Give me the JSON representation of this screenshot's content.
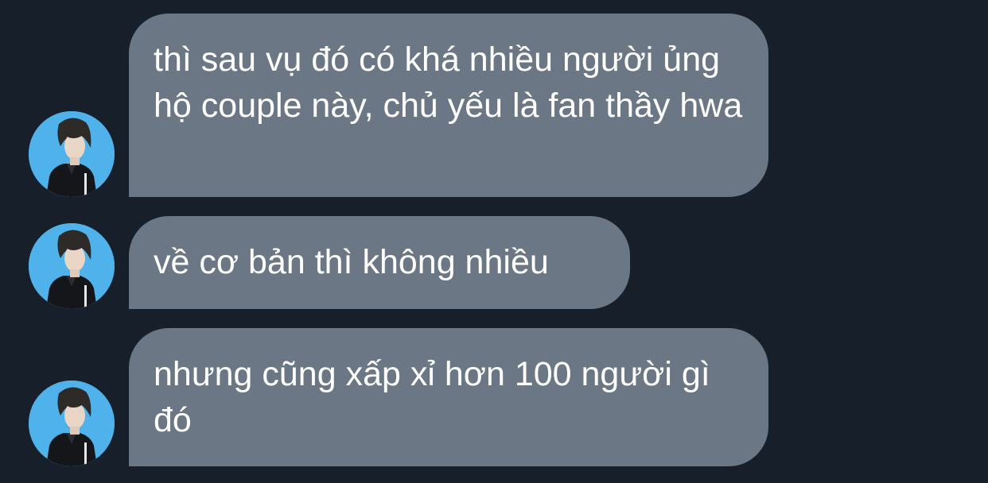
{
  "conversation": {
    "messages": [
      {
        "text": "thì sau vụ đó có khá nhiều người ủng hộ couple này, chủ yếu là fan thầy hwa"
      },
      {
        "text": "về cơ bản thì không nhiều"
      },
      {
        "text": "nhưng cũng xấp xỉ hơn 100 người gì đó"
      }
    ]
  },
  "colors": {
    "background": "#17202a",
    "bubble": "#6b7784",
    "avatar_background": "#4fb2ea",
    "text": "#ffffff"
  }
}
